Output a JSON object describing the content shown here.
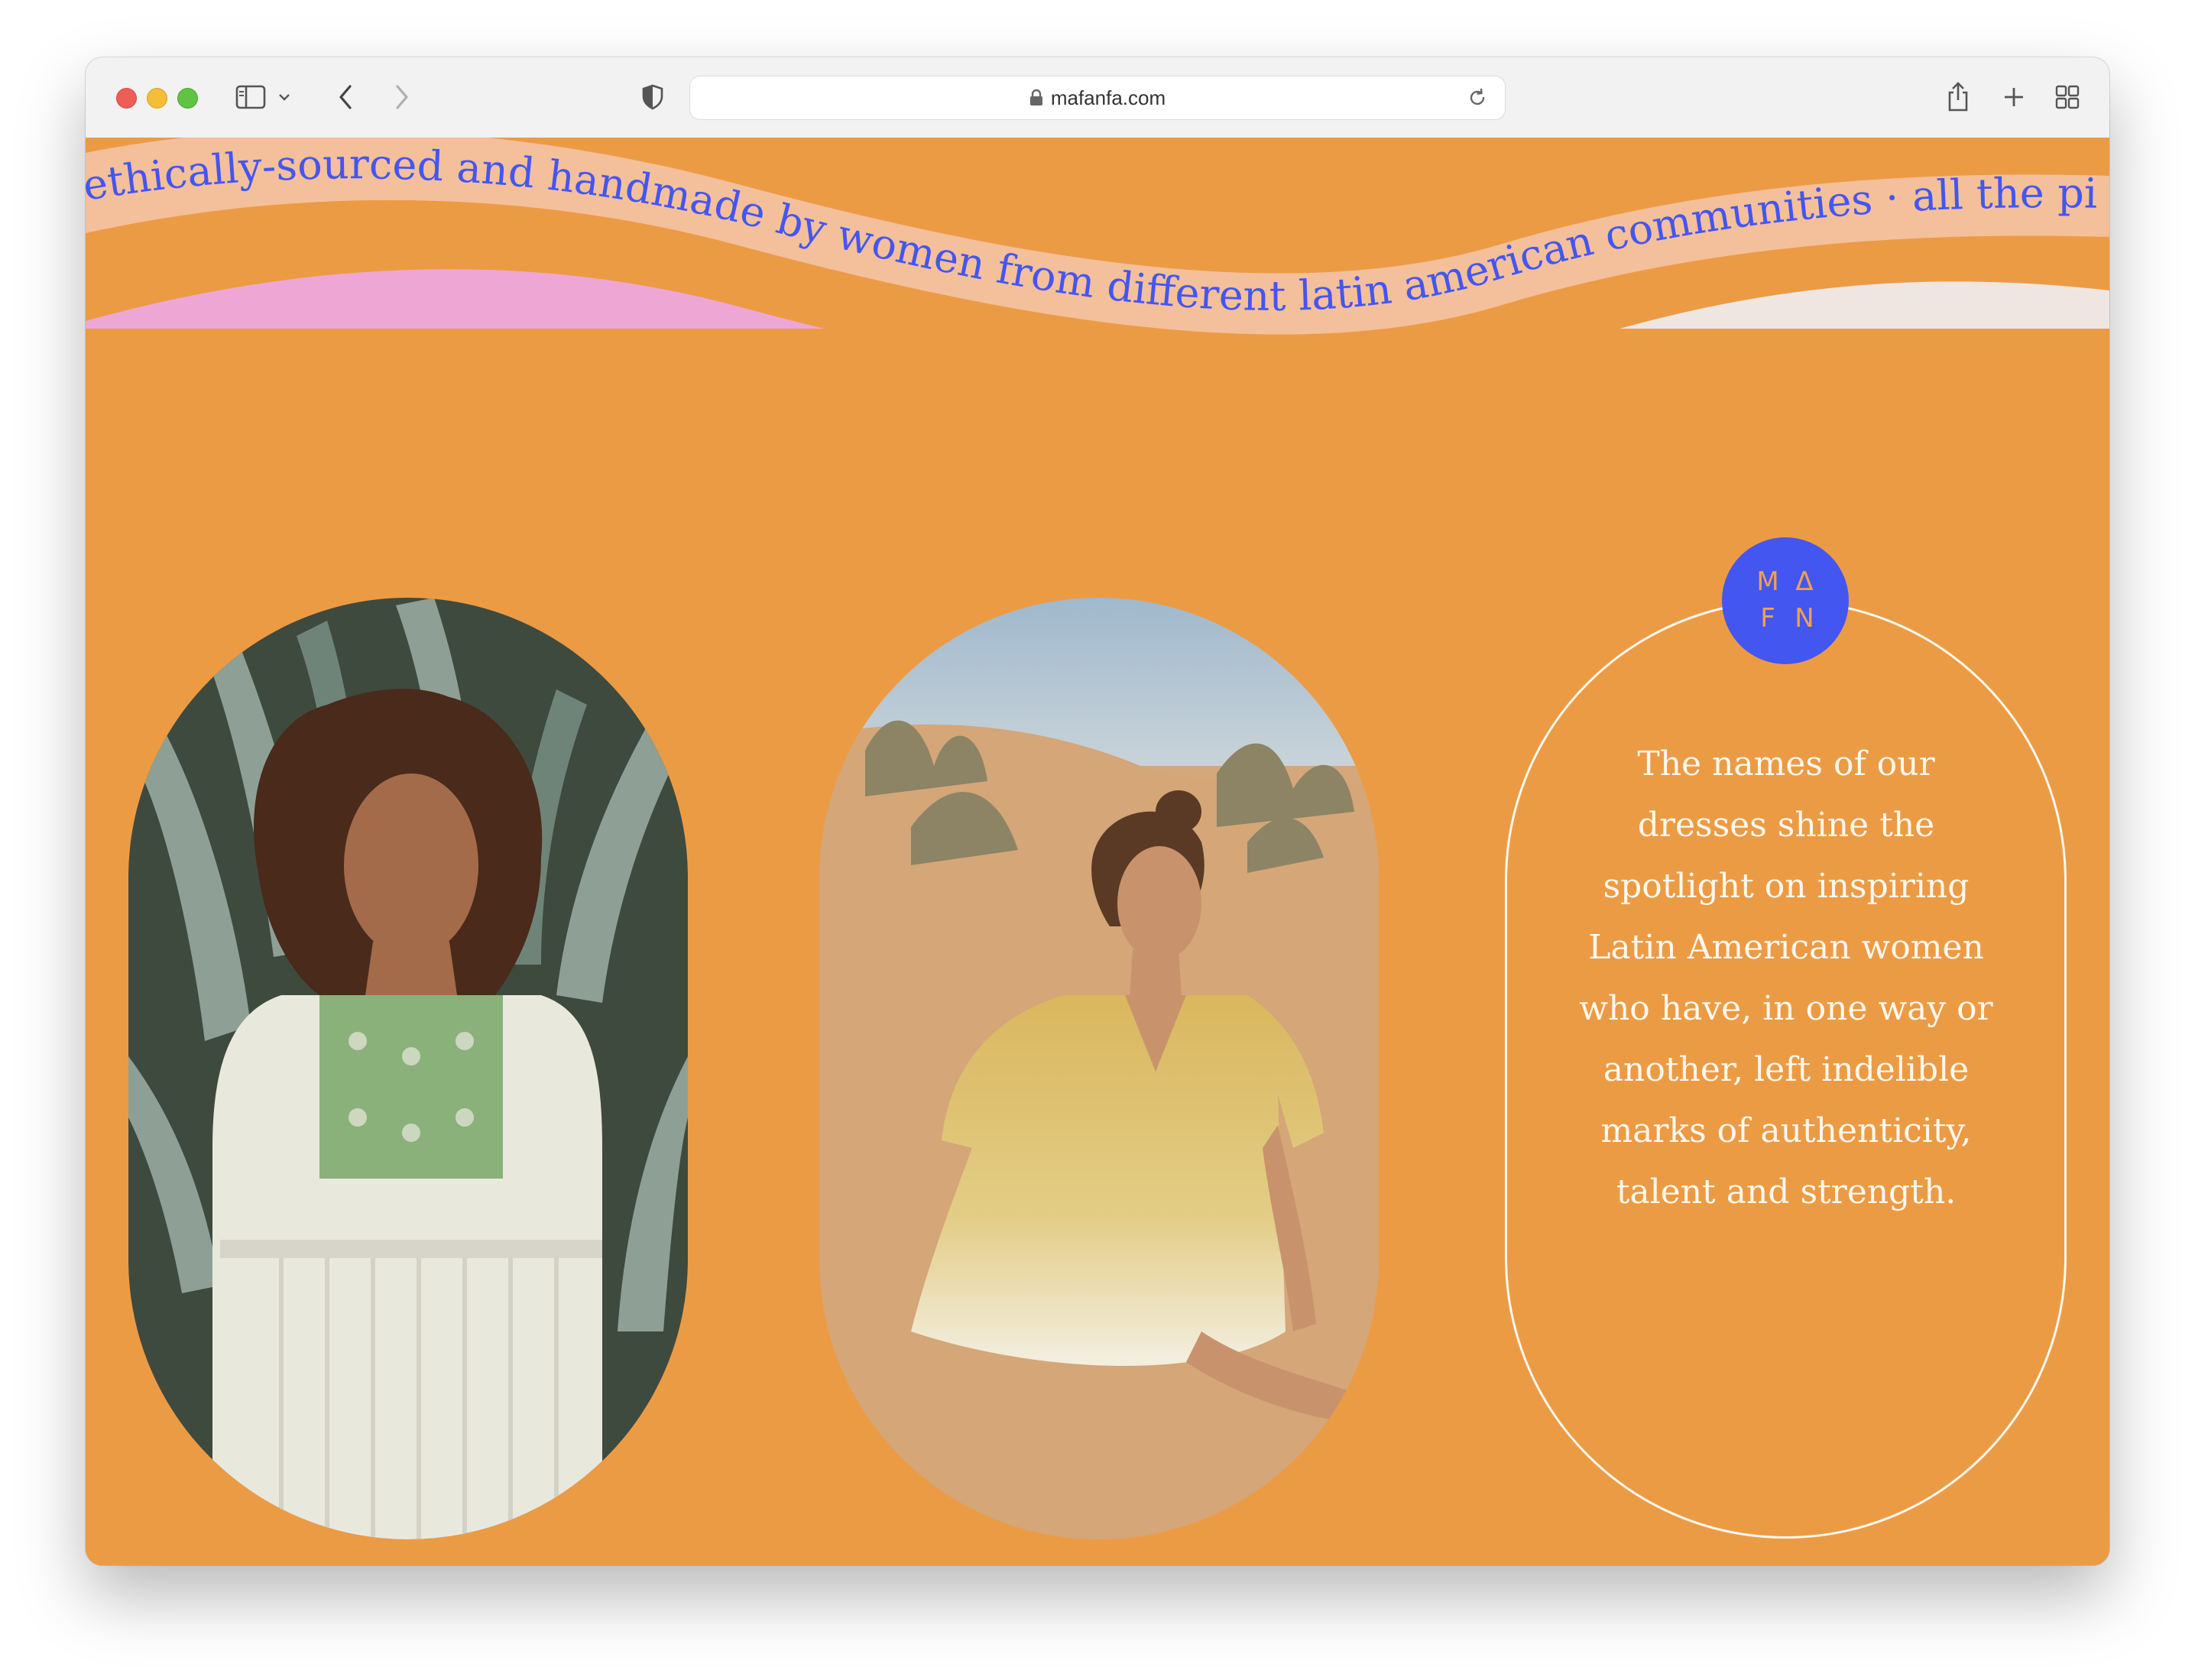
{
  "browser": {
    "url": "mafanfa.com"
  },
  "banner": {
    "marquee_text": "ethically-sourced and handmade by women from different latin american communities · all the pieces are ethically"
  },
  "logo": {
    "letters": [
      "M",
      "Δ",
      "F",
      "N"
    ]
  },
  "quote": {
    "text": "The names of our dresses shine the spotlight on inspiring Latin American women who have, in one way or another, left indelible marks of authenticity, talent and strength."
  },
  "colors": {
    "page_background": "#ec9b45",
    "pink_block": "#eea7d4",
    "wave_band": "#f4bf9b",
    "marquee_text": "#4456f0",
    "logo_circle": "#4456f0",
    "logo_letters": "#f0a24a",
    "quote_text": "#fff8ee"
  }
}
